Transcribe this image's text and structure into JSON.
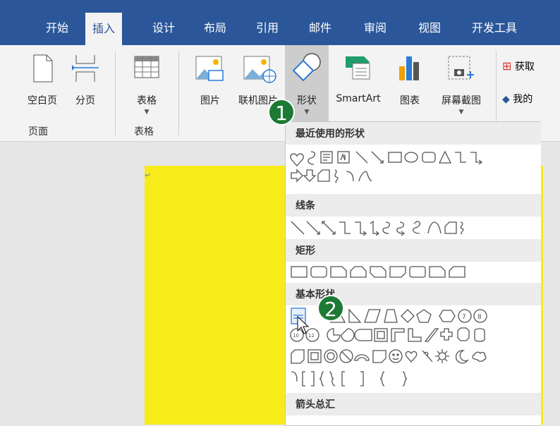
{
  "tabs": [
    {
      "id": "start",
      "label": "开始"
    },
    {
      "id": "insert",
      "label": "插入",
      "active": true
    },
    {
      "id": "design",
      "label": "设计"
    },
    {
      "id": "layout",
      "label": "布局"
    },
    {
      "id": "references",
      "label": "引用"
    },
    {
      "id": "mailings",
      "label": "邮件"
    },
    {
      "id": "review",
      "label": "审阅"
    },
    {
      "id": "view",
      "label": "视图"
    },
    {
      "id": "developer",
      "label": "开发工具"
    }
  ],
  "ribbon": {
    "blank_page": "空白页",
    "page_break": "分页",
    "table": "表格",
    "picture": "图片",
    "online_picture": "联机图片",
    "shapes": "形状",
    "smartart": "SmartArt",
    "chart": "图表",
    "screenshot": "屏幕截图",
    "get_addins": "获取",
    "my_addins": "我的",
    "group_pages": "页面",
    "group_tables": "表格"
  },
  "dropdown": {
    "recent": "最近使用的形状",
    "lines": "线条",
    "rectangles": "矩形",
    "basic": "基本形状",
    "arrows": "箭头总汇"
  },
  "badges": {
    "one": "1",
    "two": "2"
  },
  "colors": {
    "tab_bar": "#2b579a",
    "page": "#f7ec1a",
    "badge": "#1d7a34"
  }
}
